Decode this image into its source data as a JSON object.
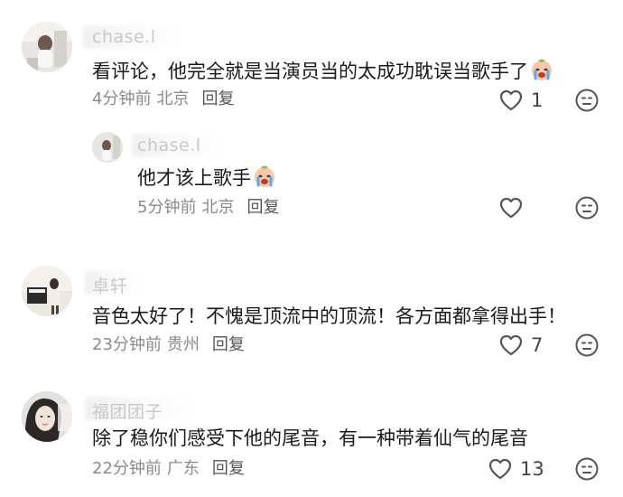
{
  "comments": [
    {
      "username": "chase.l",
      "text": "看评论，他完全就是当演员当的太成功耽误当歌手了",
      "time": "4分钟前",
      "location": "北京",
      "reply_label": "回复",
      "likes": "1",
      "emoji": "crying-face-emoji"
    },
    {
      "username": "chase.l",
      "text": "他才该上歌手",
      "time": "5分钟前",
      "location": "北京",
      "reply_label": "回复",
      "likes": "",
      "emoji": "crying-face-emoji"
    },
    {
      "username": "卓轩",
      "text": "音色太好了！不愧是顶流中的顶流！各方面都拿得出手！",
      "time": "23分钟前",
      "location": "贵州",
      "reply_label": "回复",
      "likes": "7"
    },
    {
      "username": "福团团子",
      "text": "除了稳你们感受下他的尾音，有一种带着仙气的尾音",
      "time": "22分钟前",
      "location": "广东",
      "reply_label": "回复",
      "likes": "13"
    }
  ],
  "colors": {
    "text": "#1a1a1a",
    "meta": "#8a8a8a",
    "username": "#c9c9c9",
    "icon": "#555555"
  }
}
